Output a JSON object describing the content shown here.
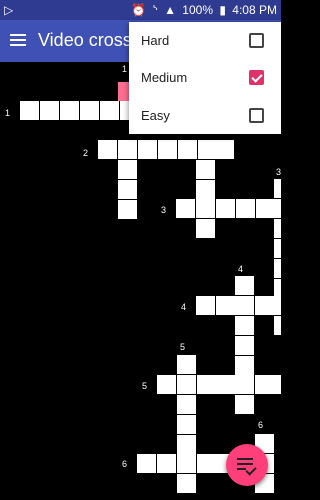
{
  "status_bar": {
    "left_icon": "play-icon",
    "alarm_icon": "alarm-icon",
    "bluetooth_icon": "bluetooth-icon",
    "signal_icon": "signal-icon",
    "battery_text": "100%",
    "battery_icon": "battery-charging-icon",
    "time": "4:08 PM"
  },
  "app_bar": {
    "menu_icon": "hamburger-menu-icon",
    "title": "Video crossw"
  },
  "difficulty_menu": {
    "items": [
      {
        "label": "Hard",
        "checked": false
      },
      {
        "label": "Medium",
        "checked": true
      },
      {
        "label": "Easy",
        "checked": false
      }
    ]
  },
  "board": {
    "clue_numbers": [
      "1",
      "1",
      "2",
      "3",
      "3",
      "4",
      "4",
      "5",
      "5",
      "6",
      "6"
    ]
  },
  "fab": {
    "icon": "playlist-check-icon"
  },
  "colors": {
    "status_bar": "#2f3a91",
    "app_bar": "#3f51b5",
    "accent": "#e0316b",
    "fab": "#ff3f7a",
    "highlight_cell": "#ff6f91"
  }
}
